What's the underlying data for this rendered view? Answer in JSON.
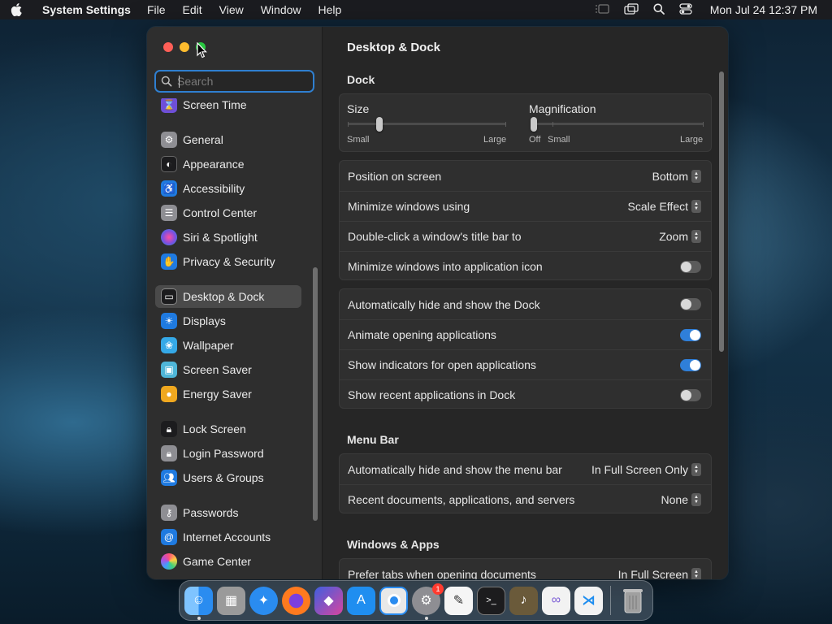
{
  "menubar": {
    "app_name": "System Settings",
    "menus": [
      "File",
      "Edit",
      "View",
      "Window",
      "Help"
    ],
    "clock": "Mon Jul 24  12:37 PM"
  },
  "sidebar": {
    "search_placeholder": "Search",
    "items": [
      {
        "label": "Screen Time",
        "icon": "hourglass-icon",
        "color": "#6e4fd8"
      },
      {
        "label": "General",
        "icon": "gear-icon",
        "color": "#8e8e93"
      },
      {
        "label": "Appearance",
        "icon": "appearance-icon",
        "color": "#1c1c1e"
      },
      {
        "label": "Accessibility",
        "icon": "accessibility-icon",
        "color": "#1f7ae0"
      },
      {
        "label": "Control Center",
        "icon": "control-center-icon",
        "color": "#8e8e93"
      },
      {
        "label": "Siri & Spotlight",
        "icon": "siri-icon",
        "color": "#b14fd8"
      },
      {
        "label": "Privacy & Security",
        "icon": "hand-icon",
        "color": "#1f7ae0"
      },
      {
        "label": "Desktop & Dock",
        "icon": "dock-icon",
        "color": "#1c1c1e"
      },
      {
        "label": "Displays",
        "icon": "displays-icon",
        "color": "#1f7ae0"
      },
      {
        "label": "Wallpaper",
        "icon": "wallpaper-icon",
        "color": "#35a9e8"
      },
      {
        "label": "Screen Saver",
        "icon": "screen-saver-icon",
        "color": "#4fb6d8"
      },
      {
        "label": "Energy Saver",
        "icon": "energy-icon",
        "color": "#f0a81f"
      },
      {
        "label": "Lock Screen",
        "icon": "lock-icon",
        "color": "#1c1c1e"
      },
      {
        "label": "Login Password",
        "icon": "login-lock-icon",
        "color": "#8e8e93"
      },
      {
        "label": "Users & Groups",
        "icon": "users-icon",
        "color": "#1f7ae0"
      },
      {
        "label": "Passwords",
        "icon": "key-icon",
        "color": "#8e8e93"
      },
      {
        "label": "Internet Accounts",
        "icon": "at-icon",
        "color": "#1f7ae0"
      },
      {
        "label": "Game Center",
        "icon": "game-center-icon",
        "color": "#e8e8e8"
      }
    ]
  },
  "content": {
    "title": "Desktop & Dock",
    "dock_section": "Dock",
    "size": {
      "label": "Size",
      "min": "Small",
      "max": "Large",
      "value_fraction": 0.2
    },
    "magnification": {
      "label": "Magnification",
      "off": "Off",
      "min": "Small",
      "max": "Large",
      "value_fraction": 0.0
    },
    "position_rows": [
      {
        "label": "Position on screen",
        "value": "Bottom"
      },
      {
        "label": "Minimize windows using",
        "value": "Scale Effect"
      },
      {
        "label": "Double-click a window's title bar to",
        "value": "Zoom"
      },
      {
        "label": "Minimize windows into application icon",
        "toggle": false
      }
    ],
    "dock_toggles": [
      {
        "label": "Automatically hide and show the Dock",
        "toggle": false
      },
      {
        "label": "Animate opening applications",
        "toggle": true
      },
      {
        "label": "Show indicators for open applications",
        "toggle": true
      },
      {
        "label": "Show recent applications in Dock",
        "toggle": false
      }
    ],
    "menubar_section": "Menu Bar",
    "menubar_rows": [
      {
        "label": "Automatically hide and show the menu bar",
        "value": "In Full Screen Only"
      },
      {
        "label": "Recent documents, applications, and servers",
        "value": "None"
      }
    ],
    "windows_section": "Windows & Apps",
    "windows_rows": [
      {
        "label": "Prefer tabs when opening documents",
        "value": "In Full Screen"
      }
    ]
  },
  "dock": {
    "apps": [
      {
        "name": "Finder",
        "icon": "finder-icon",
        "color": "#2a8cf0",
        "running": true
      },
      {
        "name": "Launchpad",
        "icon": "launchpad-icon",
        "color": "#8a8a8a"
      },
      {
        "name": "Safari",
        "icon": "safari-icon",
        "color": "#2a8cf0"
      },
      {
        "name": "Firefox",
        "icon": "firefox-icon",
        "color": "#e8572a"
      },
      {
        "name": "Shortcuts",
        "icon": "shortcuts-icon",
        "color": "#d8459f"
      },
      {
        "name": "App Store",
        "icon": "app-store-icon",
        "color": "#1f8ef0"
      },
      {
        "name": "Chrome",
        "icon": "chrome-icon",
        "color": "#e8e8e8"
      },
      {
        "name": "System Settings",
        "icon": "settings-icon",
        "color": "#8e8e93",
        "running": true,
        "badge": "1"
      },
      {
        "name": "TextEdit",
        "icon": "textedit-icon",
        "color": "#f5f5f5"
      },
      {
        "name": "Terminal",
        "icon": "terminal-icon",
        "color": "#1c1c1e"
      },
      {
        "name": "Instruments",
        "icon": "instruments-icon",
        "color": "#6a5a3a"
      },
      {
        "name": "Visual Studio",
        "icon": "visual-studio-icon",
        "color": "#7b5cd6"
      },
      {
        "name": "VS Code",
        "icon": "vscode-icon",
        "color": "#1f8ef0"
      },
      {
        "name": "Trash",
        "icon": "trash-icon",
        "color": "#9a9a9a"
      }
    ]
  }
}
